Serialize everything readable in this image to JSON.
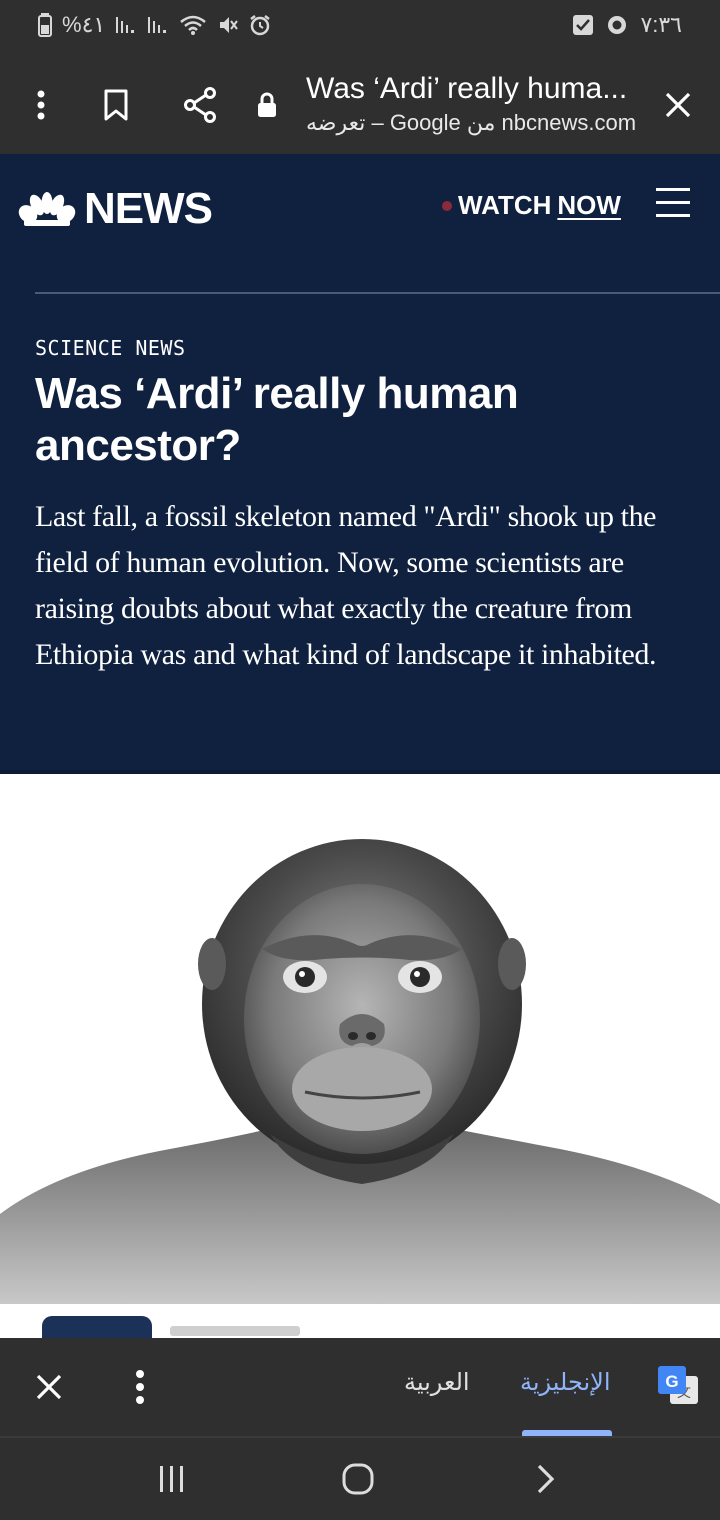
{
  "status_bar": {
    "battery_text": "%٤١",
    "time": "٧:٣٦"
  },
  "toolbar": {
    "title": "Was ‘Ardi’ really huma...",
    "subtitle": "nbcnews.com من Google – تعرضه"
  },
  "site_header": {
    "logo_text": "NEWS",
    "watch_label": "WATCH",
    "now_label": "NOW"
  },
  "article": {
    "kicker": "SCIENCE NEWS",
    "headline": "Was ‘Ardi’ really human ancestor?",
    "dek": "Last fall, a fossil skeleton named \"Ardi\" shook up the field of human evolution. Now, some scientists are raising doubts about what exactly the creature from Ethiopia was and what kind of landscape it inhabited."
  },
  "translate_bar": {
    "source_lang": "الإنجليزية",
    "target_lang": "العربية",
    "selected": "source"
  },
  "icons": {
    "toolbar": [
      "more-vert-icon",
      "bookmark-icon",
      "share-icon",
      "lock-icon",
      "close-icon"
    ],
    "nav": [
      "recents-icon",
      "home-icon",
      "back-icon"
    ]
  },
  "colors": {
    "chrome_bg": "#2f2f2f",
    "article_bg": "#10213f",
    "translate_accent": "#8fb4f9"
  }
}
